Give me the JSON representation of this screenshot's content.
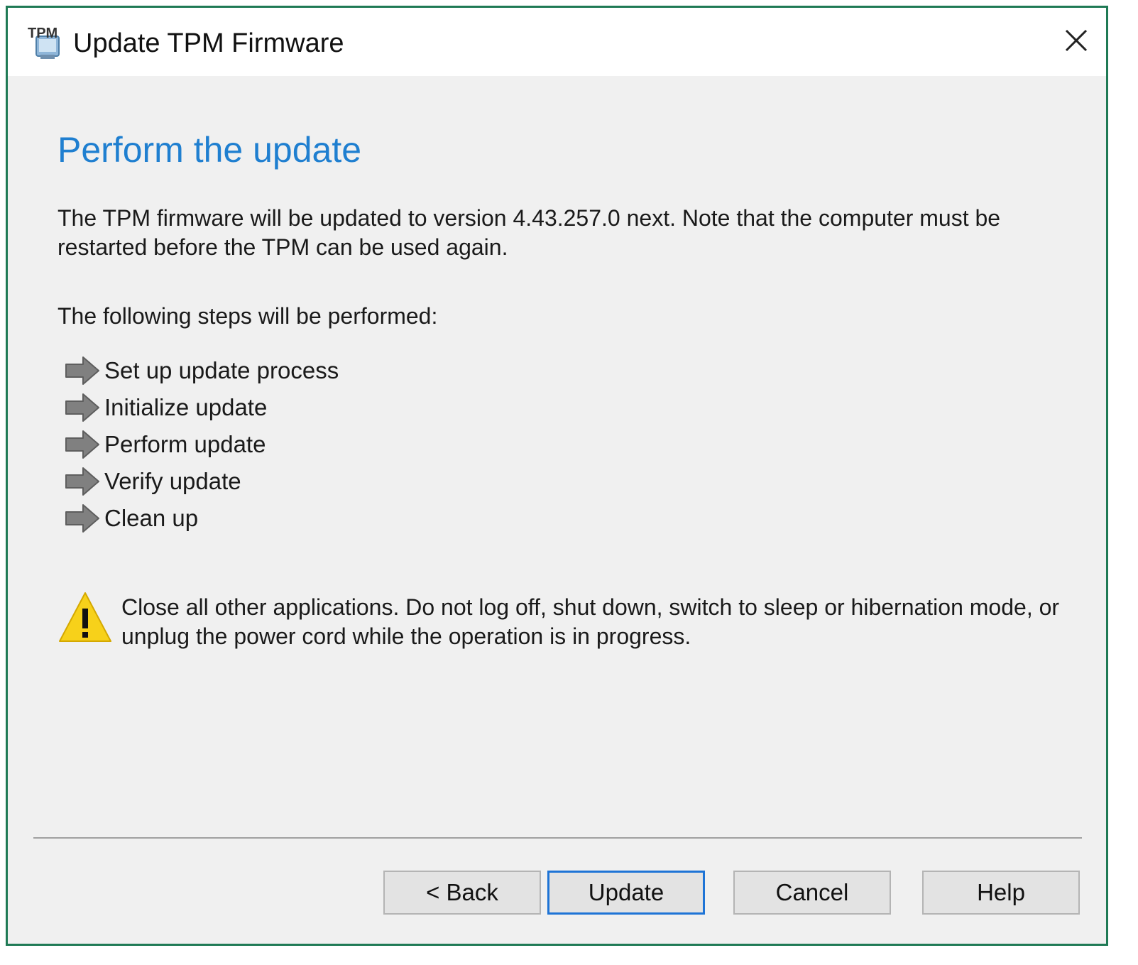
{
  "window": {
    "title": "Update TPM Firmware",
    "app_icon_text": "TPM"
  },
  "page": {
    "heading": "Perform the update",
    "intro": "The TPM firmware will be updated to version 4.43.257.0 next. Note that the computer must be restarted before the TPM can be used again.",
    "steps_label": "The following steps will be performed:",
    "steps": [
      {
        "label": "Set up update process",
        "icon": "arrow-right-icon"
      },
      {
        "label": "Initialize update",
        "icon": "arrow-right-icon"
      },
      {
        "label": "Perform update",
        "icon": "arrow-right-icon"
      },
      {
        "label": "Verify update",
        "icon": "arrow-right-icon"
      },
      {
        "label": "Clean up",
        "icon": "arrow-right-icon"
      }
    ],
    "warning": "Close all other applications. Do not log off, shut down, switch to sleep or hibernation mode, or unplug the power cord while the operation is in progress."
  },
  "buttons": {
    "back": "< Back",
    "update": "Update",
    "cancel": "Cancel",
    "help": "Help"
  },
  "colors": {
    "heading": "#1f7fd0",
    "window_border": "#1f7a55",
    "default_button_border": "#1e74d6",
    "warning_fill": "#f7d11a"
  }
}
